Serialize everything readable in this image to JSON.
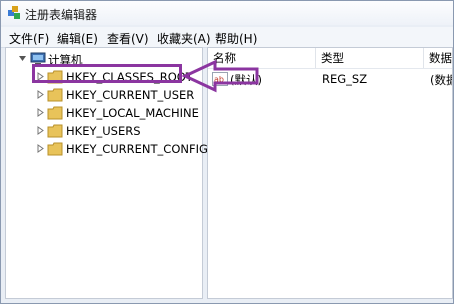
{
  "window": {
    "title": "注册表编辑器"
  },
  "menu": [
    {
      "label": "文件(F)"
    },
    {
      "label": "编辑(E)"
    },
    {
      "label": "查看(V)"
    },
    {
      "label": "收藏夹(A)"
    },
    {
      "label": "帮助(H)"
    }
  ],
  "tree": {
    "root": "计算机",
    "items": [
      {
        "label": "HKEY_CLASSES_ROOT"
      },
      {
        "label": "HKEY_CURRENT_USER"
      },
      {
        "label": "HKEY_LOCAL_MACHINE"
      },
      {
        "label": "HKEY_USERS"
      },
      {
        "label": "HKEY_CURRENT_CONFIG"
      }
    ]
  },
  "list": {
    "columns": [
      "名称",
      "类型",
      "数据"
    ],
    "rows": [
      {
        "name": "(默认)",
        "type": "REG_SZ",
        "data": "(数据"
      }
    ]
  },
  "colors": {
    "annotation": "#8b35a0",
    "folder": "#e8c35a"
  }
}
